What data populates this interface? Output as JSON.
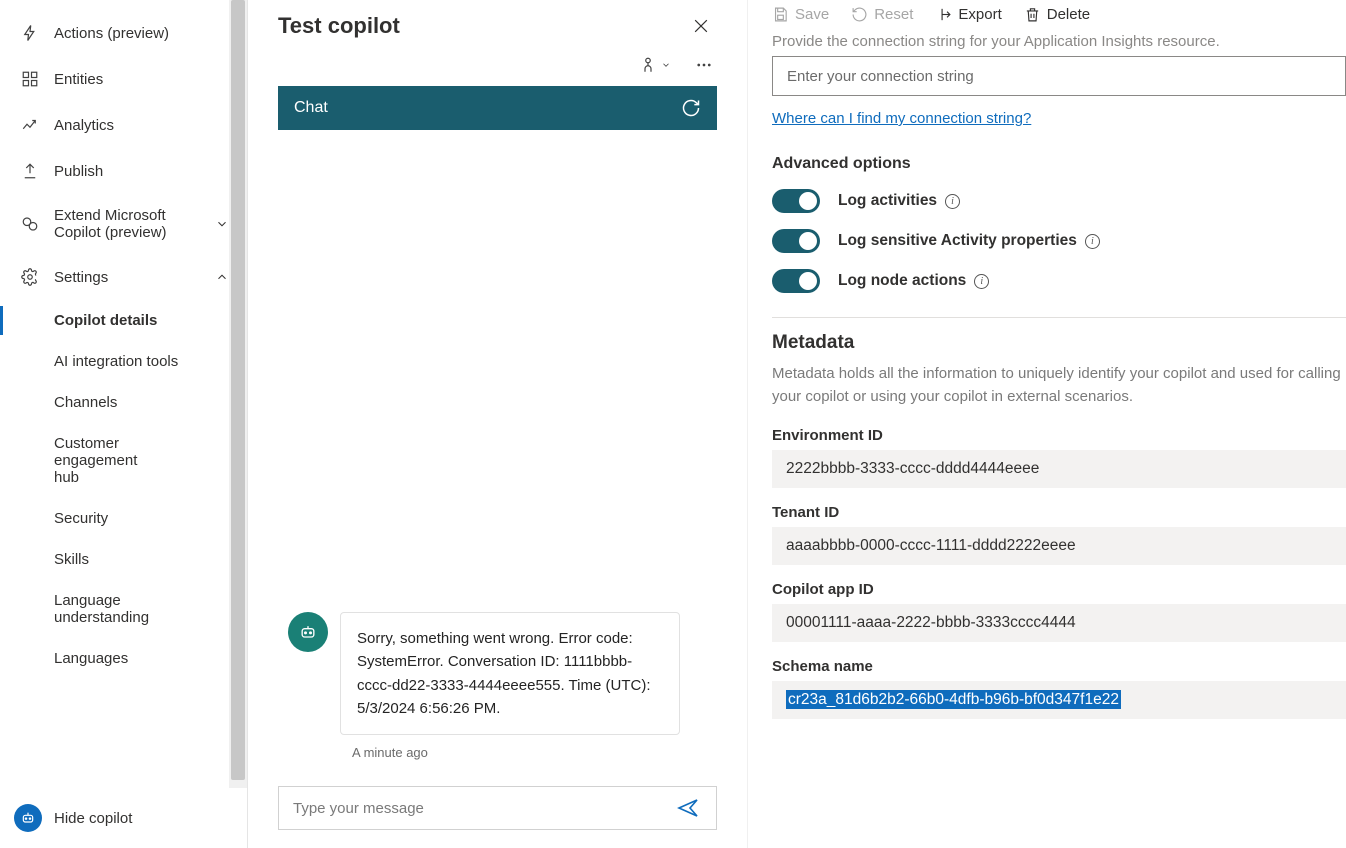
{
  "sidebar": {
    "items": [
      {
        "label": "Actions (preview)"
      },
      {
        "label": "Entities"
      },
      {
        "label": "Analytics"
      },
      {
        "label": "Publish"
      },
      {
        "label": "Extend Microsoft Copilot (preview)"
      },
      {
        "label": "Settings"
      }
    ],
    "subitems": [
      {
        "label": "Copilot details",
        "active": true
      },
      {
        "label": "AI integration tools"
      },
      {
        "label": "Channels"
      },
      {
        "label": "Customer engagement hub"
      },
      {
        "label": "Security"
      },
      {
        "label": "Skills"
      },
      {
        "label": "Language understanding"
      },
      {
        "label": "Languages"
      }
    ],
    "hide_label": "Hide copilot"
  },
  "test": {
    "title": "Test copilot",
    "chat_tab": "Chat",
    "message": "Sorry, something went wrong. Error code: SystemError. Conversation ID: 1111bbbb-cccc-dd22-3333-4444eeee555. Time (UTC): 5/3/2024 6:56:26 PM.",
    "timestamp": "A minute ago",
    "input_placeholder": "Type your message"
  },
  "actions": {
    "save": "Save",
    "reset": "Reset",
    "export": "Export",
    "delete": "Delete"
  },
  "details": {
    "trunc_text": "Provide the connection string for your Application Insights resource.",
    "conn_placeholder": "Enter your connection string",
    "conn_link": "Where can I find my connection string?",
    "advanced_heading": "Advanced options",
    "toggles": [
      {
        "label": "Log activities"
      },
      {
        "label": "Log sensitive Activity properties"
      },
      {
        "label": "Log node actions"
      }
    ],
    "metadata_heading": "Metadata",
    "metadata_desc": "Metadata holds all the information to uniquely identify your copilot and used for calling your copilot or using your copilot in external scenarios.",
    "fields": [
      {
        "label": "Environment ID",
        "value": "2222bbbb-3333-cccc-dddd4444eeee"
      },
      {
        "label": "Tenant ID",
        "value": "aaaabbbb-0000-cccc-1111-dddd2222eeee"
      },
      {
        "label": "Copilot app ID",
        "value": "00001111-aaaa-2222-bbbb-3333cccc4444"
      },
      {
        "label": "Schema name",
        "value": "cr23a_81d6b2b2-66b0-4dfb-b96b-bf0d347f1e22"
      }
    ]
  }
}
